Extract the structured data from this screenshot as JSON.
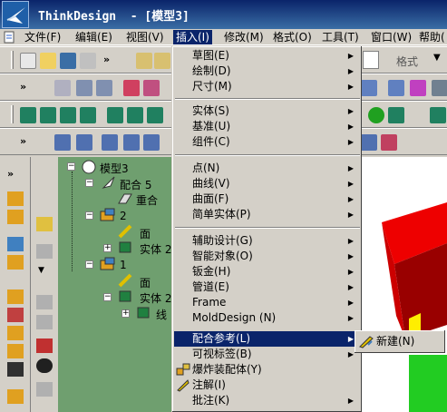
{
  "window": {
    "title": "ThinkDesign  - [模型3]"
  },
  "menubar": {
    "items": [
      "文件(F)",
      "编辑(E)",
      "视图(V)",
      "插入(I)",
      "修改(M)",
      "格式(O)",
      "工具(T)",
      "窗口(W)",
      "帮助("
    ]
  },
  "toolbar": {
    "format_label": "格式",
    "chevron": "»"
  },
  "tree": {
    "root": "模型3",
    "nodes": [
      "配合 5",
      "重合",
      "2",
      "面",
      "实体 2",
      "1",
      "面",
      "实体 2",
      "线"
    ]
  },
  "insert_menu": {
    "items": [
      "草图(E)",
      "绘制(D)",
      "尺寸(M)",
      "实体(S)",
      "基准(U)",
      "组件(C)",
      "点(N)",
      "曲线(V)",
      "曲面(F)",
      "简单实体(P)",
      "辅助设计(G)",
      "智能对象(O)",
      "钣金(H)",
      "管道(E)",
      "Frame",
      "MoldDesign (N)",
      "配合参考(L)",
      "可视标签(B)",
      "爆炸装配体(Y)",
      "注解(I)",
      "批注(K)"
    ]
  },
  "submenu": {
    "item": "新建(N)"
  },
  "colors": {
    "highlight": "#0a246a",
    "tree_bg": "#6f9f6f",
    "cube_red": "#ff0000",
    "cube_green": "#22cc22"
  }
}
